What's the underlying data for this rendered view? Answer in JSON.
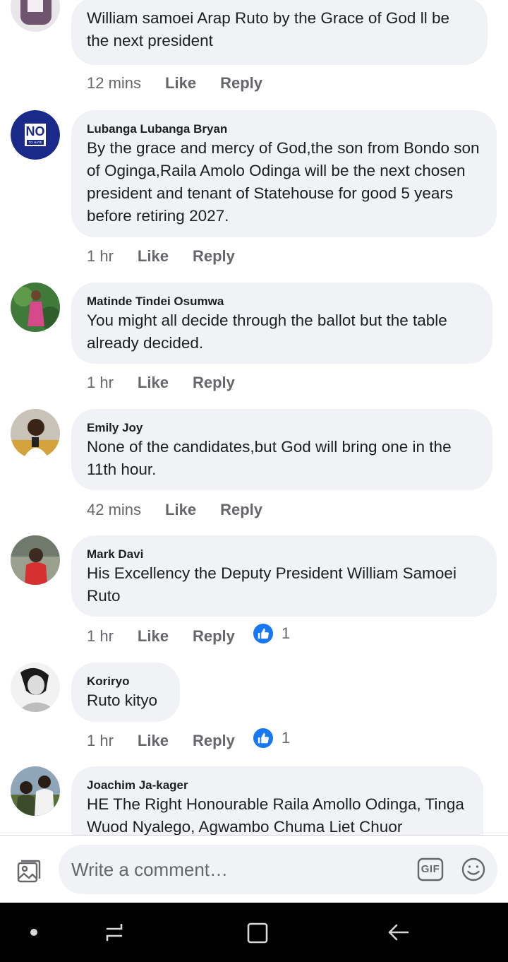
{
  "comments": [
    {
      "author": "",
      "text": "William samoei Arap Ruto by the Grace of God ll be the next president",
      "time": "12 mins",
      "like": "Like",
      "reply": "Reply"
    },
    {
      "author": "Lubanga Lubanga Bryan",
      "text": "By the grace and mercy of God,the son from Bondo son of Oginga,Raila Amolo Odinga will be the next chosen president and tenant of Statehouse for good 5 years before retiring 2027.",
      "time": "1 hr",
      "like": "Like",
      "reply": "Reply"
    },
    {
      "author": "Matinde Tindei Osumwa",
      "text": "You might all decide through the ballot but the table already decided.",
      "time": "1 hr",
      "like": "Like",
      "reply": "Reply"
    },
    {
      "author": "Emily Joy",
      "text": "None of the candidates,but God will bring one in the 11th hour.",
      "time": "42 mins",
      "like": "Like",
      "reply": "Reply"
    },
    {
      "author": "Mark Davi",
      "text": "His Excellency the Deputy President William Samoei Ruto",
      "time": "1 hr",
      "like": "Like",
      "reply": "Reply",
      "reactions": "1"
    },
    {
      "author": "Koriryo",
      "text": "Ruto kityo",
      "time": "1 hr",
      "like": "Like",
      "reply": "Reply",
      "reactions": "1"
    },
    {
      "author": "Joachim Ja-kager",
      "text": "HE The Right Honourable Raila Amollo Odinga, Tinga Wuod Nyalego, Agwambo Chuma Liet Chuor"
    }
  ],
  "avatar_badge": {
    "big": "NO",
    "small": "TO HATE"
  },
  "composer": {
    "placeholder": "Write a comment…",
    "gif_label": "GIF"
  },
  "colors": {
    "bubble": "#f0f2f5",
    "like_blue": "#1877f2",
    "meta_gray": "#65676b",
    "navbar": "#000000"
  },
  "icons": [
    "photo-icon",
    "gif-icon",
    "emoji-icon",
    "dot-icon",
    "recent-apps-icon",
    "home-icon",
    "back-icon",
    "thumbs-up-icon"
  ]
}
